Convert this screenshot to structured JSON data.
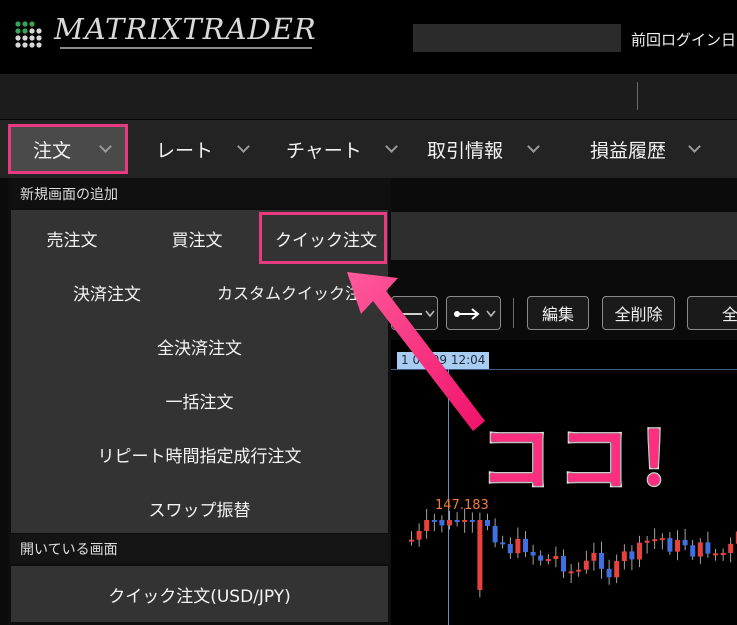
{
  "header": {
    "logo_text": "MATRIXTRADER",
    "login_label": "前回ログイン日時"
  },
  "menubar": {
    "items": [
      {
        "label": "注文"
      },
      {
        "label": "レート"
      },
      {
        "label": "チャート"
      },
      {
        "label": "取引情報"
      },
      {
        "label": "損益履歴"
      }
    ]
  },
  "dropdown": {
    "section_new": "新規画面の追加",
    "items": [
      {
        "label": "売注文"
      },
      {
        "label": "買注文"
      },
      {
        "label": "クイック注文"
      },
      {
        "label": "決済注文"
      },
      {
        "label": "カスタムクイック注文"
      },
      {
        "label": "全決済注文"
      },
      {
        "label": "一括注文"
      },
      {
        "label": "リピート時間指定成行注文"
      },
      {
        "label": "スワップ振替"
      }
    ],
    "section_open": "開いている画面",
    "open_items": [
      {
        "label": "クイック注文(USD/JPY)"
      }
    ]
  },
  "toolbar": {
    "edit_label": "編集",
    "delete_all_label": "全削除",
    "all_label": "全"
  },
  "chart": {
    "date_tag": "1 07/09 12:04",
    "price_label": "147.183"
  },
  "annotation": {
    "text": "ココ！",
    "color": "#ff2f7f"
  },
  "colors": {
    "highlight": "#e83a7e",
    "candle_up": "#e8423c",
    "candle_down": "#3f6fe0"
  }
}
